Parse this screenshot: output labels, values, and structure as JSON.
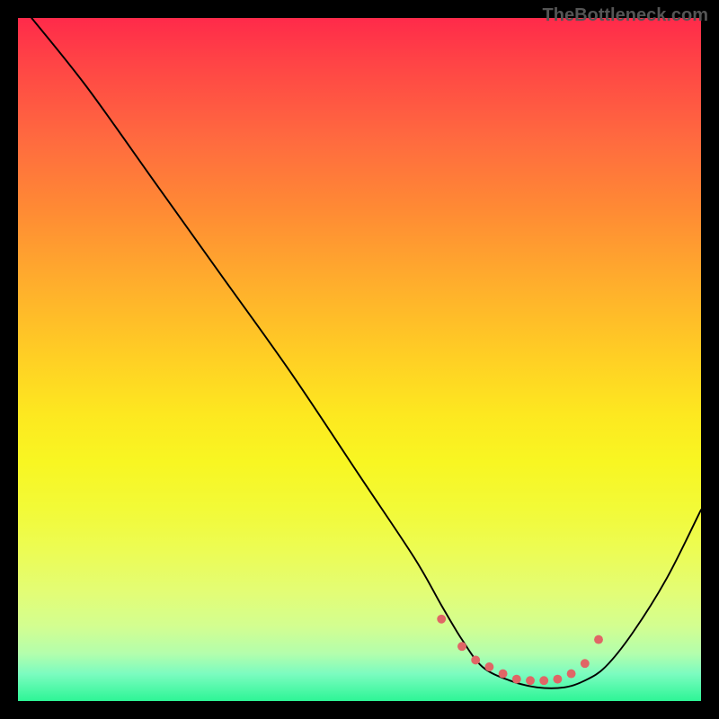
{
  "watermark": "TheBottleneck.com",
  "chart_data": {
    "type": "line",
    "title": "",
    "xlabel": "",
    "ylabel": "",
    "xlim": [
      0,
      100
    ],
    "ylim": [
      0,
      100
    ],
    "series": [
      {
        "name": "curve",
        "x": [
          2,
          10,
          20,
          30,
          40,
          50,
          58,
          62,
          65,
          68,
          72,
          76,
          80,
          83,
          86,
          90,
          95,
          100
        ],
        "y": [
          100,
          90,
          76,
          62,
          48,
          33,
          21,
          14,
          9,
          5,
          3,
          2,
          2,
          3,
          5,
          10,
          18,
          28
        ]
      }
    ],
    "markers": {
      "name": "dots",
      "color": "#e06666",
      "x": [
        62,
        65,
        67,
        69,
        71,
        73,
        75,
        77,
        79,
        81,
        83,
        85
      ],
      "y": [
        12,
        8,
        6,
        5,
        4,
        3.2,
        3,
        3,
        3.2,
        4,
        5.5,
        9
      ]
    }
  }
}
